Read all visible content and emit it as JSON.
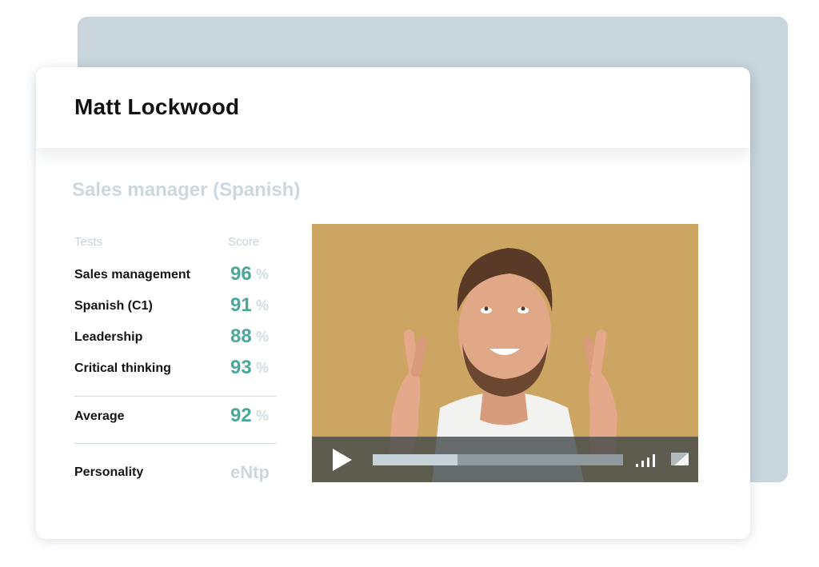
{
  "candidate": {
    "name": "Matt Lockwood",
    "job_title": "Sales manager (Spanish)"
  },
  "columns": {
    "tests": "Tests",
    "score": "Score"
  },
  "tests": [
    {
      "label": "Sales management",
      "value": "96",
      "unit": "%"
    },
    {
      "label": "Spanish (C1)",
      "value": "91",
      "unit": "%"
    },
    {
      "label": "Leadership",
      "value": "88",
      "unit": "%"
    },
    {
      "label": "Critical thinking",
      "value": "93",
      "unit": "%"
    }
  ],
  "average": {
    "label": "Average",
    "value": "92",
    "unit": "%"
  },
  "personality": {
    "label": "Personality",
    "value": "eNtp"
  },
  "video": {
    "progress": 0.34,
    "volume_level": 4,
    "background_color": "#cda562",
    "icons": {
      "play": "play-icon",
      "volume": "volume-icon",
      "fullscreen": "fullscreen-icon"
    }
  },
  "colors": {
    "accent": "#4aa89a",
    "muted": "#ccd8df",
    "backdrop": "#c8d5dc"
  }
}
